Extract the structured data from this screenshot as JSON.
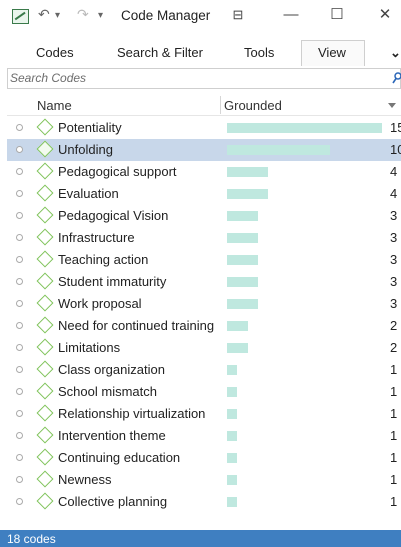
{
  "window": {
    "title": "Code Manager",
    "undo_icon": "undo-icon",
    "redo_icon": "redo-icon",
    "customize_icon": "dropdown-arrow-icon",
    "pin_glyph": "⊟",
    "minimize_glyph": "—",
    "maximize_glyph": "☐",
    "close_glyph": "✕"
  },
  "menu": {
    "codes": "Codes",
    "search_filter": "Search & Filter",
    "tools": "Tools",
    "view": "View",
    "more_glyph": "⌄",
    "active": "View"
  },
  "search": {
    "placeholder": "Search Codes",
    "icon": "search-icon"
  },
  "table": {
    "columns": [
      "Name",
      "Grounded"
    ],
    "max_grounded": 15,
    "rows": [
      {
        "name": "Potentiality",
        "grounded": 15,
        "selected": false
      },
      {
        "name": "Unfolding",
        "grounded": 10,
        "selected": true
      },
      {
        "name": "Pedagogical support",
        "grounded": 4,
        "selected": false
      },
      {
        "name": "Evaluation",
        "grounded": 4,
        "selected": false
      },
      {
        "name": "Pedagogical Vision",
        "grounded": 3,
        "selected": false
      },
      {
        "name": "Infrastructure",
        "grounded": 3,
        "selected": false
      },
      {
        "name": "Teaching action",
        "grounded": 3,
        "selected": false
      },
      {
        "name": "Student immaturity",
        "grounded": 3,
        "selected": false
      },
      {
        "name": "Work proposal",
        "grounded": 3,
        "selected": false
      },
      {
        "name": "Need for continued training",
        "grounded": 2,
        "selected": false
      },
      {
        "name": "Limitations",
        "grounded": 2,
        "selected": false
      },
      {
        "name": "Class organization",
        "grounded": 1,
        "selected": false
      },
      {
        "name": "School mismatch",
        "grounded": 1,
        "selected": false
      },
      {
        "name": "Relationship virtualization",
        "grounded": 1,
        "selected": false
      },
      {
        "name": "Intervention theme",
        "grounded": 1,
        "selected": false
      },
      {
        "name": "Continuing education",
        "grounded": 1,
        "selected": false
      },
      {
        "name": "Newness",
        "grounded": 1,
        "selected": false
      },
      {
        "name": "Collective planning",
        "grounded": 1,
        "selected": false
      }
    ]
  },
  "status": {
    "text": "18 codes"
  },
  "colors": {
    "bar": "#bfe8df",
    "selection": "#c8d7ea",
    "status_bar": "#3f7fc1",
    "code_icon": "#7fc35a"
  }
}
